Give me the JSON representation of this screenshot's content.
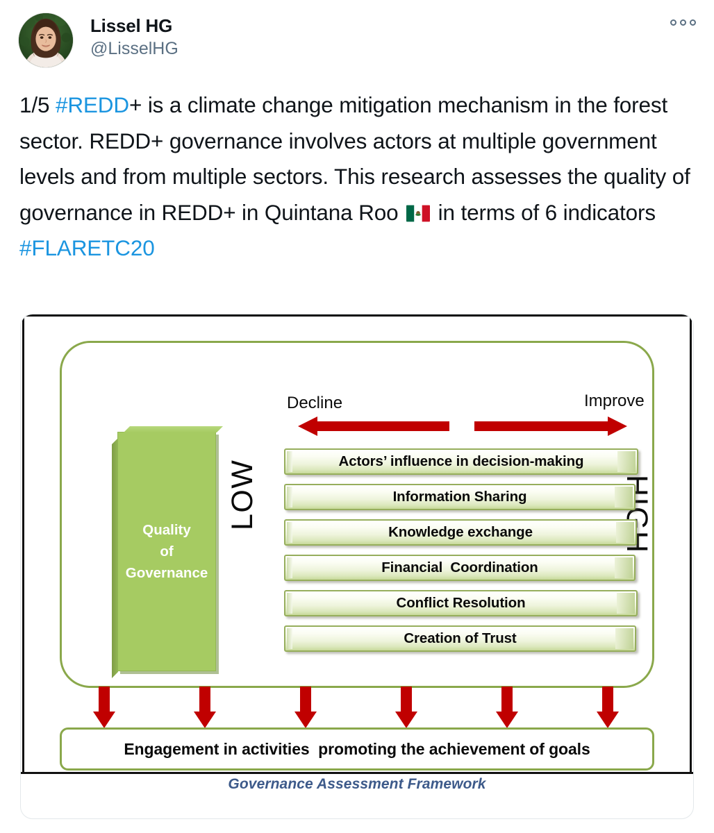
{
  "tweet": {
    "author": {
      "display_name": "Lissel HG",
      "handle": "@LisselHG"
    },
    "more_menu_label": "More",
    "body": {
      "prefix": "1/5 ",
      "hashtag_redd": "#REDD",
      "segment_1": "+ is a climate change mitigation mechanism in the forest sector. REDD+ governance involves actors at multiple government levels and from multiple sectors. This research assesses the quality of governance in REDD+ in Quintana Roo ",
      "flag_alt": "mexico-flag",
      "segment_2": " in terms of 6 indicators ",
      "hashtag_flare": "#FLARETC20"
    }
  },
  "figure": {
    "caption": "Governance Assessment Framework",
    "axis": {
      "left_label": "Decline",
      "right_label": "Improve"
    },
    "scale": {
      "low": "LOW",
      "high": "HIGH"
    },
    "core_box": {
      "line1": "Quality",
      "line2": "of",
      "line3": "Governance"
    },
    "indicators": [
      "Actors’ influence in decision-making",
      "Information Sharing",
      "Knowledge exchange",
      "Financial  Coordination",
      "Conflict Resolution",
      "Creation of Trust"
    ],
    "outcome": "Engagement in activities  promoting the achievement of goals",
    "colors": {
      "green_fill": "#a6cb62",
      "green_border": "#8aa84b",
      "arrow_red": "#c00000",
      "bar_border": "#96ae5c",
      "caption_blue": "#3d5a8a",
      "link_blue": "#1b95e0"
    }
  }
}
